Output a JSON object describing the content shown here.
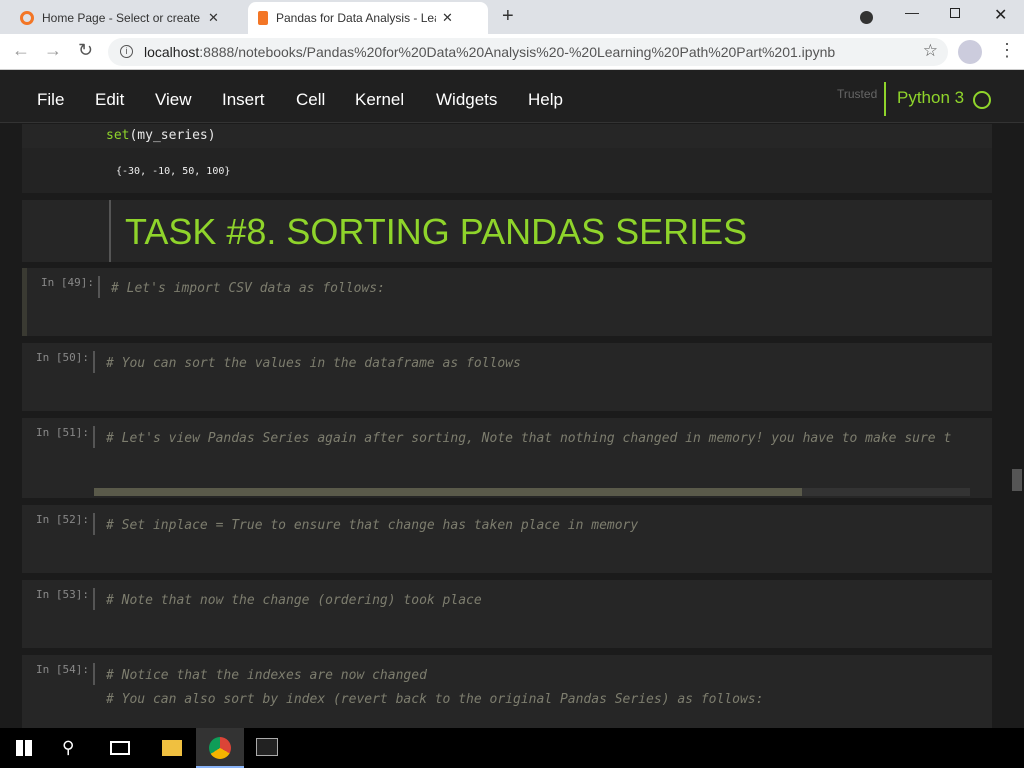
{
  "browser": {
    "tabs": [
      {
        "title": "Home Page - Select or create a n"
      },
      {
        "title": "Pandas for Data Analysis - Learni"
      }
    ],
    "url_host": "localhost",
    "url_rest": ":8888/notebooks/Pandas%20for%20Data%20Analysis%20-%20Learning%20Path%20Part%201.ipynb"
  },
  "menu": {
    "items": [
      "File",
      "Edit",
      "View",
      "Insert",
      "Cell",
      "Kernel",
      "Widgets",
      "Help"
    ],
    "trusted": "Trusted",
    "kernel": "Python 3"
  },
  "cells": {
    "partial_code": "set(my_series)",
    "output": "{-30, -10, 50, 100}",
    "heading": "TASK #8. SORTING PANDAS SERIES",
    "list": [
      {
        "prompt": "In [49]:",
        "lines": [
          "# Let's import CSV data as follows:"
        ]
      },
      {
        "prompt": "In [50]:",
        "lines": [
          "# You can sort the values in the dataframe as follows"
        ]
      },
      {
        "prompt": "In [51]:",
        "lines": [
          "# Let's view Pandas Series again after sorting, Note that nothing changed in memory! you have to make sure t"
        ]
      },
      {
        "prompt": "In [52]:",
        "lines": [
          "# Set inplace = True to ensure that change has taken place in memory"
        ]
      },
      {
        "prompt": "In [53]:",
        "lines": [
          "# Note that now the change (ordering) took place"
        ]
      },
      {
        "prompt": "In [54]:",
        "lines": [
          "# Notice that the indexes are now changed",
          "# You can also sort by index (revert back to the original Pandas Series) as follows:"
        ]
      }
    ]
  },
  "colors": {
    "accent": "#8fd42b"
  }
}
